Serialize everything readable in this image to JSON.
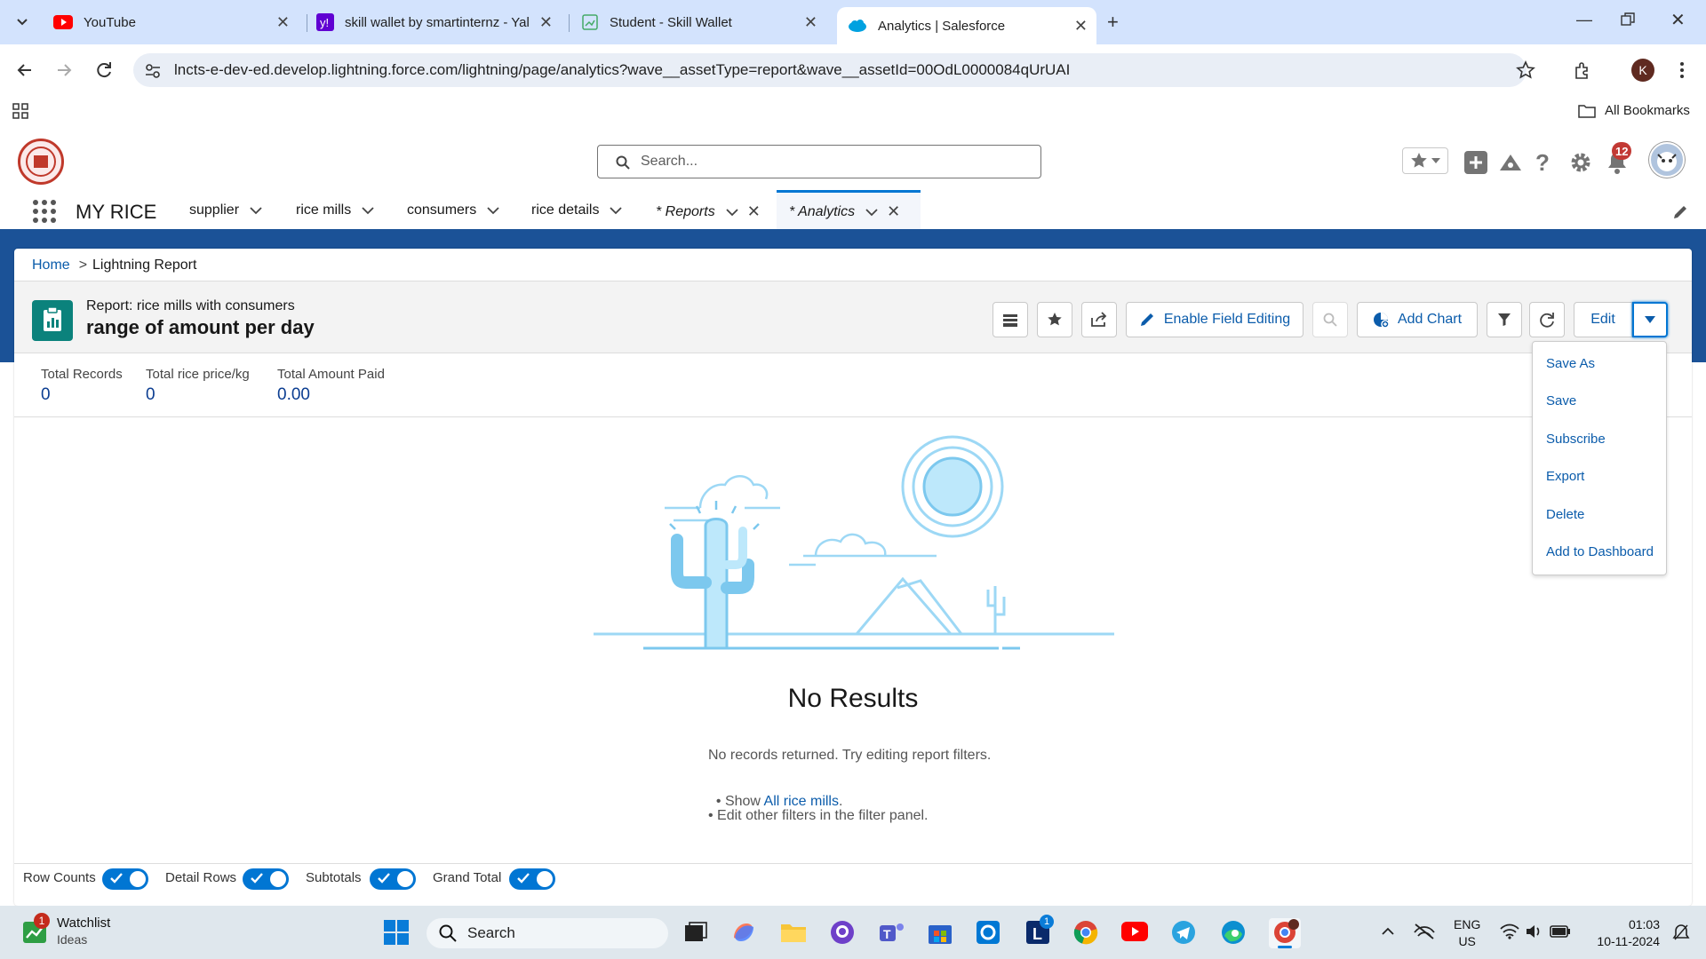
{
  "browser": {
    "tabs": [
      {
        "title": "YouTube"
      },
      {
        "title": "skill wallet by smartinternz - Yal"
      },
      {
        "title": "Student - Skill Wallet"
      },
      {
        "title": "Analytics | Salesforce"
      }
    ],
    "url": "lncts-e-dev-ed.develop.lightning.force.com/lightning/page/analytics?wave__assetType=report&wave__assetId=00OdL0000084qUrUAI",
    "profile_initial": "K",
    "bookmarks_label": "All Bookmarks"
  },
  "sf": {
    "search_placeholder": "Search...",
    "notification_count": "12",
    "app_name": "MY RICE",
    "nav": [
      {
        "label": "supplier"
      },
      {
        "label": "rice mills"
      },
      {
        "label": "consumers"
      },
      {
        "label": "rice details"
      },
      {
        "label": "* Reports"
      },
      {
        "label": "* Analytics"
      }
    ]
  },
  "breadcrumb": {
    "home": "Home",
    "sep": ">",
    "current": "Lightning Report"
  },
  "report": {
    "subtitle": "Report: rice mills with consumers",
    "title": "range of amount per day",
    "buttons": {
      "enable_field_editing": "Enable Field Editing",
      "add_chart": "Add Chart",
      "edit": "Edit"
    },
    "kpis": [
      {
        "label": "Total Records",
        "value": "0"
      },
      {
        "label": "Total rice price/kg",
        "value": "0"
      },
      {
        "label": "Total Amount Paid",
        "value": "0.00"
      }
    ],
    "menu": [
      "Save As",
      "Save",
      "Subscribe",
      "Export",
      "Delete",
      "Add to Dashboard"
    ],
    "empty": {
      "heading": "No Results",
      "line1": "No records returned. Try editing report filters.",
      "line2_prefix": "• Show ",
      "line2_link": "All rice mills",
      "line2_suffix": ".",
      "line3": "• Edit other filters in the filter panel."
    },
    "footer_toggles": [
      {
        "label": "Row Counts",
        "on": true
      },
      {
        "label": "Detail Rows",
        "on": true
      },
      {
        "label": "Subtotals",
        "on": true
      },
      {
        "label": "Grand Total",
        "on": true
      }
    ]
  },
  "taskbar": {
    "widget_title": "Watchlist",
    "widget_sub": "Ideas",
    "widget_badge": "1",
    "search_label": "Search",
    "lang": "ENG",
    "region": "US",
    "time": "01:03",
    "date": "10-11-2024",
    "L_badge": "1"
  },
  "colors": {
    "brand": "#0176d3",
    "banner": "#1b5297",
    "badge": "#c23934"
  }
}
